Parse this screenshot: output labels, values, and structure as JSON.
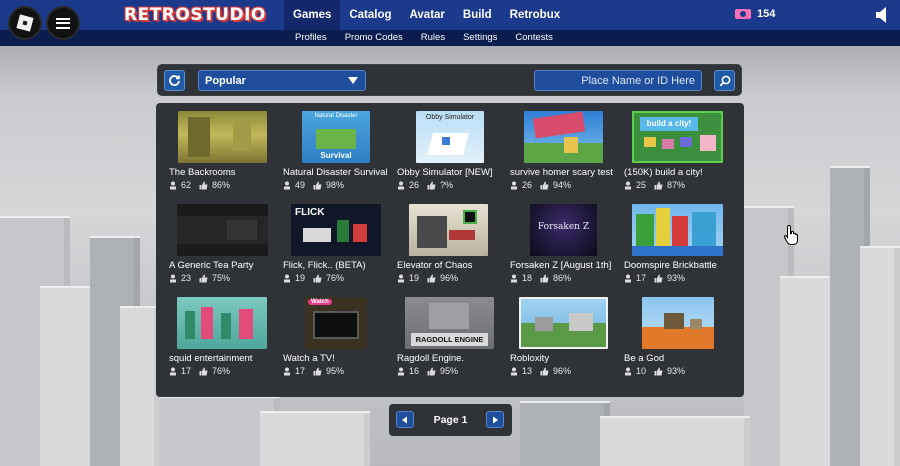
{
  "brand": "RETROSTUDIO",
  "nav": {
    "main": [
      "Games",
      "Catalog",
      "Avatar",
      "Build",
      "Retrobux"
    ],
    "sub": [
      "Profiles",
      "Promo Codes",
      "Rules",
      "Settings",
      "Contests"
    ]
  },
  "currency": {
    "amount": "154"
  },
  "toolbar": {
    "sort_selected": "Popular",
    "search_placeholder": "Place Name or ID Here"
  },
  "games": [
    {
      "name": "The Backrooms",
      "players": "62",
      "rating": "86%"
    },
    {
      "name": "Natural Disaster Survival",
      "players": "49",
      "rating": "98%",
      "thumb_text": "Natural Disaster",
      "thumb_text2": "Survival"
    },
    {
      "name": "Obby Simulator [NEW]",
      "players": "26",
      "rating": "?%",
      "thumb_text": "Obby Simulator"
    },
    {
      "name": "survive homer scary test",
      "players": "26",
      "rating": "94%"
    },
    {
      "name": "(150K) build a city!",
      "players": "25",
      "rating": "87%",
      "thumb_text": "build a city!"
    },
    {
      "name": "A Generic Tea Party",
      "players": "23",
      "rating": "75%"
    },
    {
      "name": "Flick, Flick.. (BETA)",
      "players": "19",
      "rating": "76%",
      "thumb_text": "FLICK"
    },
    {
      "name": "Elevator of Chaos",
      "players": "19",
      "rating": "96%"
    },
    {
      "name": "Forsaken Z [August 1th]",
      "players": "18",
      "rating": "86%",
      "thumb_text": "Forsaken Z"
    },
    {
      "name": "Doomspire Brickbattle",
      "players": "17",
      "rating": "93%"
    },
    {
      "name": "squid entertainment",
      "players": "17",
      "rating": "76%"
    },
    {
      "name": "Watch a TV!",
      "players": "17",
      "rating": "95%",
      "thumb_text": "Watch"
    },
    {
      "name": "Ragdoll Engine.",
      "players": "16",
      "rating": "95%",
      "thumb_text": "RAGDOLL ENGINE"
    },
    {
      "name": "Robloxity",
      "players": "13",
      "rating": "96%"
    },
    {
      "name": "Be a God",
      "players": "10",
      "rating": "93%"
    }
  ],
  "pagination": {
    "label": "Page 1"
  },
  "colors": {
    "topbar": "#1b3a8c",
    "subbar": "#0b1d4f",
    "panel": "#2f3338",
    "button": "#1f4f9c"
  }
}
